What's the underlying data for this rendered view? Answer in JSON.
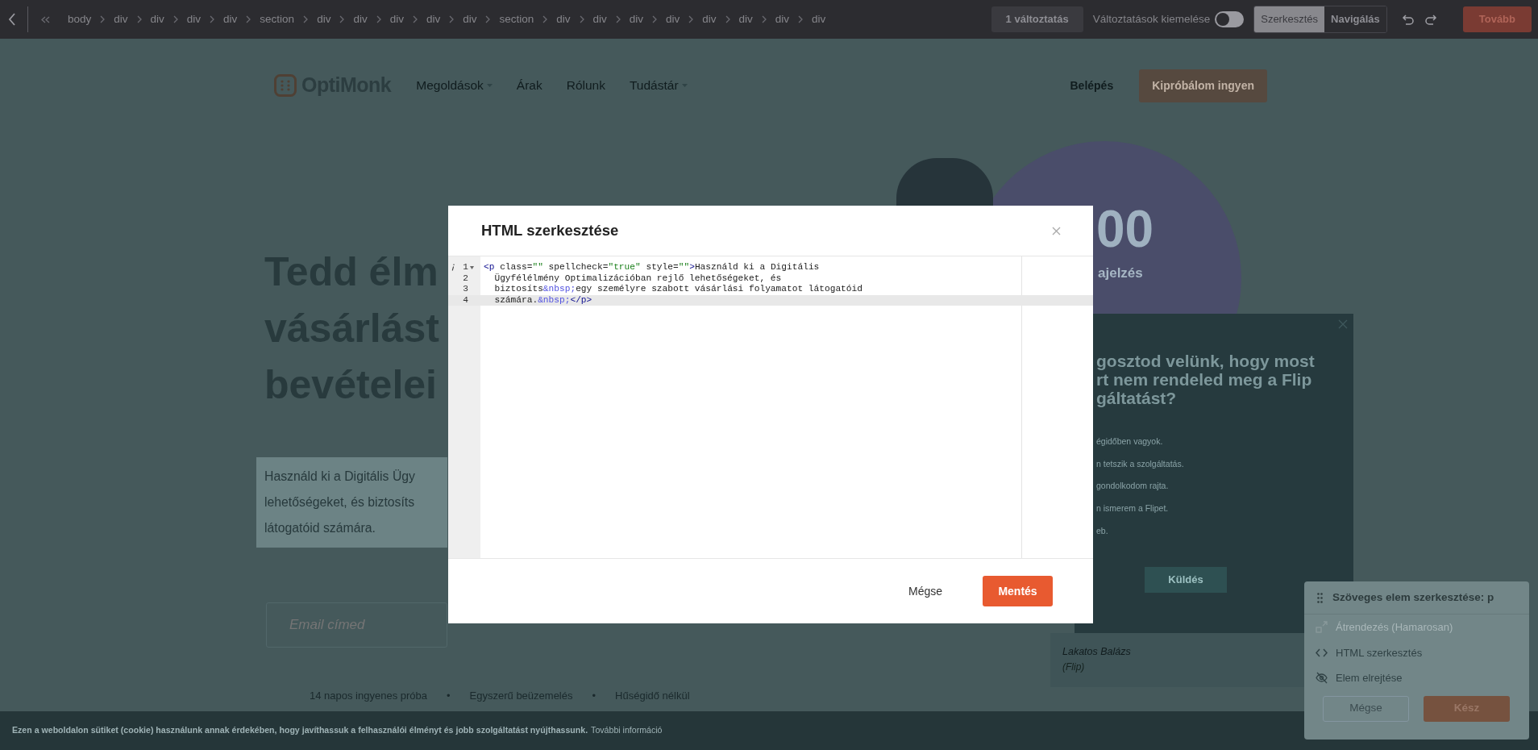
{
  "toolbar": {
    "breadcrumbs": [
      "body",
      "div",
      "div",
      "div",
      "div",
      "section",
      "div",
      "div",
      "div",
      "div",
      "div",
      "section",
      "div",
      "div",
      "div",
      "div",
      "div",
      "div",
      "div",
      "div"
    ],
    "changes_button": "1 változtatás",
    "highlight_label": "Változtatások kiemelése",
    "highlight_on": false,
    "modes": [
      {
        "label": "Szerkesztés",
        "selected": true
      },
      {
        "label": "Navigálás",
        "selected": false
      }
    ],
    "next_button": "Tovább"
  },
  "site": {
    "logo": "OptiMonk",
    "nav": [
      {
        "label": "Megoldások",
        "dropdown": true
      },
      {
        "label": "Árak",
        "dropdown": false
      },
      {
        "label": "Rólunk",
        "dropdown": false
      },
      {
        "label": "Tudástár",
        "dropdown": true
      }
    ],
    "login": "Belépés",
    "cta": "Kipróbálom ingyen",
    "headline": [
      "Tedd élm",
      "vásárlást",
      "bevételei"
    ],
    "selected_paragraph": [
      "Használd ki a Digitális Ügy",
      "lehetőségeket, és biztosíts",
      "látogatóid számára."
    ],
    "email_placeholder": "Email címed",
    "features": [
      "14 napos ingyenes próba",
      "•",
      "Egyszerű beüzemelés",
      "•",
      "Hűségidő nélkül"
    ],
    "stat_number": "00",
    "stat_label": "ajelzés",
    "survey": {
      "title": [
        "gosztod velünk, hogy most",
        "rt nem rendeled meg a Flip",
        "gáltatást?"
      ],
      "options": [
        "égidőben vagyok.",
        "n tetszik a szolgáltatás.",
        "gondolkodom rajta.",
        "n ismerem a Flipet.",
        "eb."
      ],
      "submit": "Küldés"
    },
    "testimonial": {
      "name": "Lakatos Balázs",
      "company": "(Flip)"
    }
  },
  "cookie_bar": {
    "text": "Ezen a weboldalon sütiket (cookie) használunk annak érdekében, hogy javíthassuk a felhasználói élményt és jobb szolgáltatást nyújthassunk.",
    "link": "További információ"
  },
  "modal": {
    "title": "HTML szerkesztése",
    "code_lines": [
      {
        "number": "1",
        "info": true,
        "foldable": true,
        "active": false,
        "indent": false,
        "segments": [
          {
            "kind": "tag",
            "text": "<p"
          },
          {
            "kind": "attr",
            "text": "class="
          },
          {
            "kind": "string",
            "text": "\"\""
          },
          {
            "kind": "attr",
            "text": "spellcheck="
          },
          {
            "kind": "string",
            "text": "\"true\""
          },
          {
            "kind": "attr",
            "text": "style="
          },
          {
            "kind": "string",
            "text": "\"\""
          },
          {
            "kind": "tag",
            "text": ">"
          },
          {
            "kind": "text",
            "text": "Használd ki a Digitális"
          }
        ]
      },
      {
        "number": "2",
        "info": false,
        "foldable": false,
        "active": false,
        "indent": true,
        "segments": [
          {
            "kind": "text",
            "text": "Ügyfélélmény Optimalizációban rejlő lehetőségeket, és"
          }
        ]
      },
      {
        "number": "3",
        "info": false,
        "foldable": false,
        "active": false,
        "indent": true,
        "segments": [
          {
            "kind": "text",
            "text": "biztosíts"
          },
          {
            "kind": "entity",
            "text": "&nbsp;"
          },
          {
            "kind": "text",
            "text": "egy személyre szabott vásárlási folyamatot látogatóid"
          }
        ]
      },
      {
        "number": "4",
        "info": false,
        "foldable": false,
        "active": true,
        "indent": true,
        "segments": [
          {
            "kind": "text",
            "text": "számára."
          },
          {
            "kind": "entity",
            "text": "&nbsp;"
          },
          {
            "kind": "tag",
            "text": "</p>"
          }
        ]
      }
    ],
    "buttons": [
      {
        "label": "Mégse",
        "kind": "secondary"
      },
      {
        "label": "Mentés",
        "kind": "primary"
      }
    ]
  },
  "edit_panel": {
    "title": "Szöveges elem szerkesztése: p",
    "actions": [
      {
        "label": "Átrendezés (Hamarosan)",
        "disabled": true
      },
      {
        "label": "HTML szerkesztés",
        "disabled": false
      },
      {
        "label": "Elem elrejtése",
        "disabled": false
      }
    ],
    "buttons": [
      {
        "label": "Mégse",
        "kind": "secondary"
      },
      {
        "label": "Kész",
        "kind": "primary"
      }
    ]
  }
}
